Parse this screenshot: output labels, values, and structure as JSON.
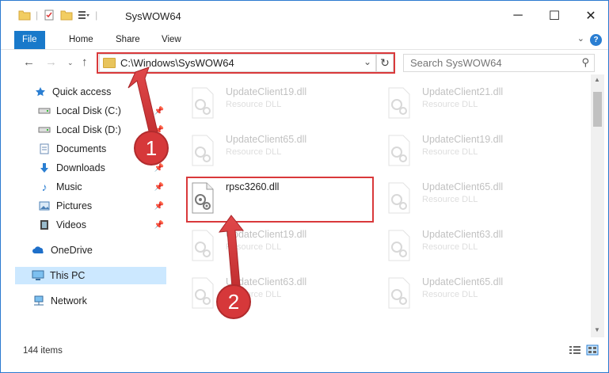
{
  "window": {
    "title": "SysWOW64",
    "controls": {
      "minimize": "─",
      "maximize": "☐",
      "close": "✕"
    }
  },
  "ribbon": {
    "tabs": [
      {
        "label": "File"
      },
      {
        "label": "Home"
      },
      {
        "label": "Share"
      },
      {
        "label": "View"
      }
    ],
    "help_label": "?"
  },
  "navigation": {
    "address_path": "C:\\Windows\\SysWOW64",
    "search_placeholder": "Search SysWOW64"
  },
  "sidebar": {
    "items": [
      {
        "label": "Quick access",
        "icon": "star-icon",
        "pinned": false
      },
      {
        "label": "Local Disk (C:)",
        "icon": "drive-icon",
        "pinned": true
      },
      {
        "label": "Local Disk (D:)",
        "icon": "drive-icon",
        "pinned": true
      },
      {
        "label": "Documents",
        "icon": "documents-icon",
        "pinned": false
      },
      {
        "label": "Downloads",
        "icon": "downloads-icon",
        "pinned": true
      },
      {
        "label": "Music",
        "icon": "music-icon",
        "pinned": true
      },
      {
        "label": "Pictures",
        "icon": "pictures-icon",
        "pinned": true
      },
      {
        "label": "Videos",
        "icon": "videos-icon",
        "pinned": true
      },
      {
        "label": "OneDrive",
        "icon": "onedrive-icon",
        "pinned": false
      },
      {
        "label": "This PC",
        "icon": "computer-icon",
        "pinned": false,
        "selected": true
      },
      {
        "label": "Network",
        "icon": "network-icon",
        "pinned": false
      }
    ]
  },
  "files": [
    {
      "name": "UpdateClient19.dll",
      "type": "Resource DLL",
      "highlighted": false
    },
    {
      "name": "UpdateClient21.dll",
      "type": "Resource DLL",
      "highlighted": false
    },
    {
      "name": "UpdateClient65.dll",
      "type": "Resource DLL",
      "highlighted": false
    },
    {
      "name": "UpdateClient19.dll",
      "type": "Resource DLL",
      "highlighted": false
    },
    {
      "name": "rpsc3260.dll",
      "type": "",
      "highlighted": true
    },
    {
      "name": "UpdateClient65.dll",
      "type": "Resource DLL",
      "highlighted": false
    },
    {
      "name": "UpdateClient19.dll",
      "type": "Resource DLL",
      "highlighted": false
    },
    {
      "name": "UpdateClient63.dll",
      "type": "Resource DLL",
      "highlighted": false
    },
    {
      "name": "UpdateClient63.dll",
      "type": "Resource DLL",
      "highlighted": false
    },
    {
      "name": "UpdateClient65.dll",
      "type": "Resource DLL",
      "highlighted": false
    }
  ],
  "status": {
    "item_count": "144 items"
  },
  "annotations": {
    "step1": "1",
    "step2": "2",
    "highlight_color": "#d9393b"
  }
}
